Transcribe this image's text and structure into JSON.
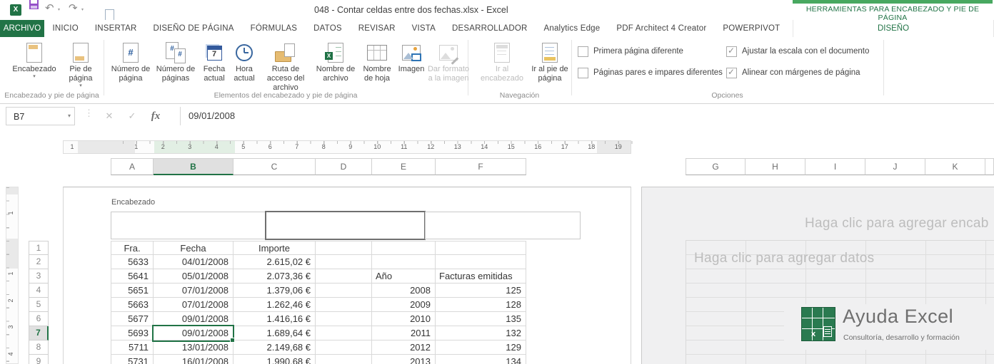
{
  "colors": {
    "excel_green": "#217346",
    "contextual_accent": "#48a860",
    "selection_green": "#217346",
    "page2_bg": "#f0f0f1",
    "header_band_orange": "#e9c27f",
    "disabled_text": "#bdbdbd"
  },
  "window": {
    "title": "048 - Contar celdas entre dos fechas.xlsx - Excel",
    "contextual_group": "HERRAMIENTAS PARA ENCABEZADO Y PIE DE PÁGINA"
  },
  "qat": {
    "icons": [
      "excel-logo",
      "save",
      "undo",
      "redo",
      "new-document",
      "open-folder",
      "customize-quick-access"
    ]
  },
  "tabs": [
    {
      "label": "ARCHIVO",
      "active": true
    },
    {
      "label": "INICIO"
    },
    {
      "label": "INSERTAR"
    },
    {
      "label": "DISEÑO DE PÁGINA"
    },
    {
      "label": "FÓRMULAS"
    },
    {
      "label": "DATOS"
    },
    {
      "label": "REVISAR"
    },
    {
      "label": "VISTA"
    },
    {
      "label": "DESARROLLADOR"
    },
    {
      "label": "Analytics Edge"
    },
    {
      "label": "PDF Architect 4 Creator"
    },
    {
      "label": "POWERPIVOT"
    },
    {
      "label": "DISEÑO",
      "contextual": true,
      "active": true
    }
  ],
  "ribbon": {
    "groups": [
      {
        "label": "Encabezado y pie de página"
      },
      {
        "label": "Elementos del encabezado y pie de página"
      },
      {
        "label": "Navegación"
      },
      {
        "label": "Opciones"
      }
    ],
    "buttons": {
      "encabezado": "Encabezado",
      "pie_de_pagina": "Pie de página",
      "numero_de_pagina": "Número de página",
      "numero_de_paginas": "Número de páginas",
      "fecha_actual": "Fecha actual",
      "hora_actual": "Hora actual",
      "ruta_de_acceso": "Ruta de acceso del archivo",
      "nombre_de_archivo": "Nombre de archivo",
      "nombre_de_hoja": "Nombre de hoja",
      "imagen": "Imagen",
      "dar_formato": "Dar formato a la imagen",
      "ir_al_encabezado": "Ir al encabezado",
      "ir_al_pie": "Ir al pie de página"
    },
    "options": [
      {
        "label": "Primera página diferente",
        "checked": false
      },
      {
        "label": "Páginas pares e impares diferentes",
        "checked": false
      },
      {
        "label": "Ajustar la escala con el documento",
        "checked": true
      },
      {
        "label": "Alinear con márgenes de página",
        "checked": true
      }
    ]
  },
  "formula_bar": {
    "name_box": "B7",
    "fx": "fx",
    "formula": "09/01/2008"
  },
  "ruler": {
    "h_margin": "1",
    "h_numbers": [
      "1",
      "2",
      "3",
      "4",
      "5",
      "6",
      "7",
      "8",
      "9",
      "10",
      "11",
      "12",
      "13",
      "14",
      "15",
      "16",
      "17",
      "18",
      "19"
    ],
    "v_margin": "1",
    "v_numbers": [
      "1",
      "2",
      "3",
      "4"
    ]
  },
  "sheet": {
    "columns_page1": [
      "A",
      "B",
      "C",
      "D",
      "E",
      "F"
    ],
    "columns_page2": [
      "G",
      "H",
      "I",
      "J",
      "K"
    ],
    "selected_column": "B",
    "row_numbers": [
      "1",
      "2",
      "3",
      "4",
      "5",
      "6",
      "7",
      "8",
      "9"
    ],
    "selected_row": "7",
    "selected_cell": "B7",
    "header_caption": "Encabezado",
    "table_rows": [
      [
        "Fra.",
        "Fecha",
        "Importe",
        "",
        "",
        ""
      ],
      [
        "5633",
        "04/01/2008",
        "2.615,02 €",
        "",
        "",
        ""
      ],
      [
        "5641",
        "05/01/2008",
        "2.073,36 €",
        "",
        "Año",
        "Facturas emitidas"
      ],
      [
        "5651",
        "07/01/2008",
        "1.379,06 €",
        "",
        "2008",
        "125"
      ],
      [
        "5663",
        "07/01/2008",
        "1.262,46 €",
        "",
        "2009",
        "128"
      ],
      [
        "5677",
        "09/01/2008",
        "1.416,16 €",
        "",
        "2010",
        "135"
      ],
      [
        "5693",
        "09/01/2008",
        "1.689,64 €",
        "",
        "2011",
        "132"
      ],
      [
        "5711",
        "13/01/2008",
        "2.149,68 €",
        "",
        "2012",
        "129"
      ],
      [
        "5731",
        "16/01/2008",
        "1.990,68 €",
        "",
        "2013",
        "134"
      ]
    ]
  },
  "page2": {
    "header_placeholder": "Haga clic para agregar encab",
    "data_placeholder": "Haga clic para agregar datos",
    "logo": {
      "name": "Ayuda Excel",
      "tagline": "Consultoría, desarrollo y formación"
    }
  }
}
